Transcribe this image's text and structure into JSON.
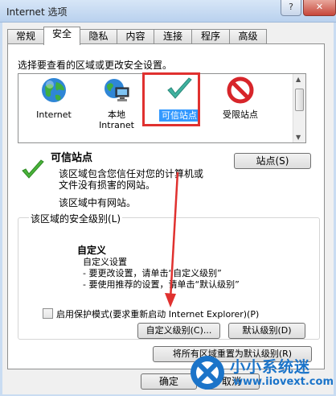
{
  "window": {
    "title": "Internet 选项",
    "help_glyph": "?",
    "close_glyph": "✕"
  },
  "tabs": [
    {
      "label": "常规"
    },
    {
      "label": "安全"
    },
    {
      "label": "隐私"
    },
    {
      "label": "内容"
    },
    {
      "label": "连接"
    },
    {
      "label": "程序"
    },
    {
      "label": "高级"
    }
  ],
  "active_tab": "安全",
  "security": {
    "instruction": "选择要查看的区域或更改安全设置。",
    "zones": [
      {
        "label": "Internet",
        "icon": "globe-icon"
      },
      {
        "label": "本地\nIntranet",
        "icon": "intranet-icon"
      },
      {
        "label": "可信站点",
        "icon": "checkmark-icon",
        "selected": true
      },
      {
        "label": "受限站点",
        "icon": "no-entry-icon"
      }
    ],
    "zone_title": "可信站点",
    "sites_button": "站点(S)",
    "zone_desc_1": "该区域包含您信任对您的计算机或",
    "zone_desc_2": "文件没有损害的网站。",
    "zone_has_sites": "该区域中有网站。",
    "level_group_label": "该区域的安全级别(L)",
    "level_name": "自定义",
    "level_line_1": "自定义设置",
    "level_line_2": "- 要更改设置，请单击“自定义级别”",
    "level_line_3": "- 要使用推荐的设置，请单击“默认级别”",
    "protected_mode_label": "启用保护模式(要求重新启动 Internet Explorer)(P)",
    "protected_mode_checked": false,
    "custom_level_button": "自定义级别(C)...",
    "default_level_button": "默认级别(D)",
    "reset_all_button": "将所有区域重置为默认级别(R)"
  },
  "footer": {
    "ok_button": "确定",
    "cancel_button": "取消"
  },
  "watermark": {
    "name": "小小系统迷",
    "url": "www.iiovext.com"
  },
  "colors": {
    "selection": "#3399ff",
    "highlight_box": "#e0312f",
    "annotation_arrow": "#e0312f",
    "watermark": "#1b74c9"
  }
}
